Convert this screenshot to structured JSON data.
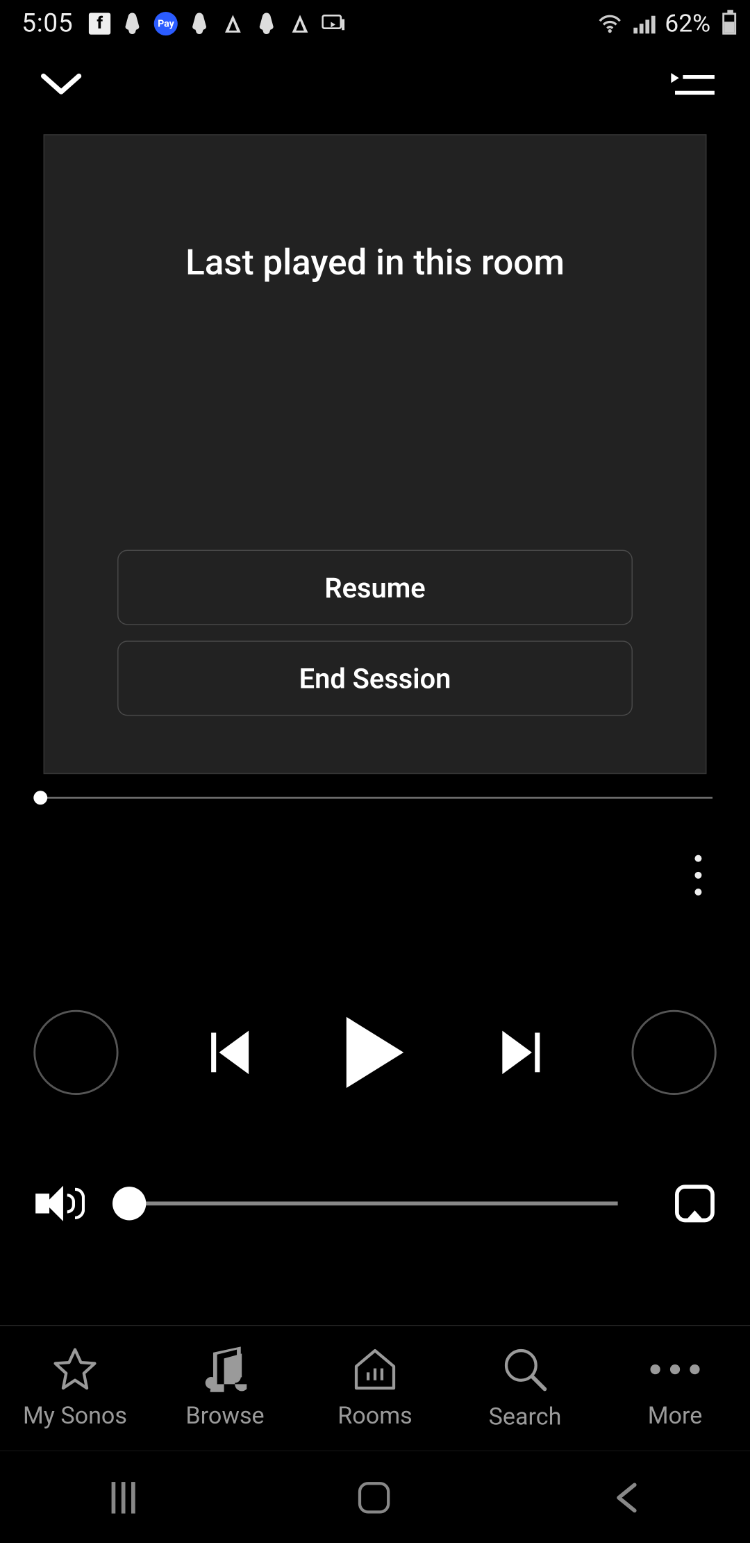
{
  "status": {
    "time": "5:05",
    "battery_percent": "62%"
  },
  "session_card": {
    "title": "Last played in this room",
    "resume_label": "Resume",
    "end_label": "End Session"
  },
  "tabs": {
    "my_sonos": "My Sonos",
    "browse": "Browse",
    "rooms": "Rooms",
    "search": "Search",
    "more": "More"
  }
}
